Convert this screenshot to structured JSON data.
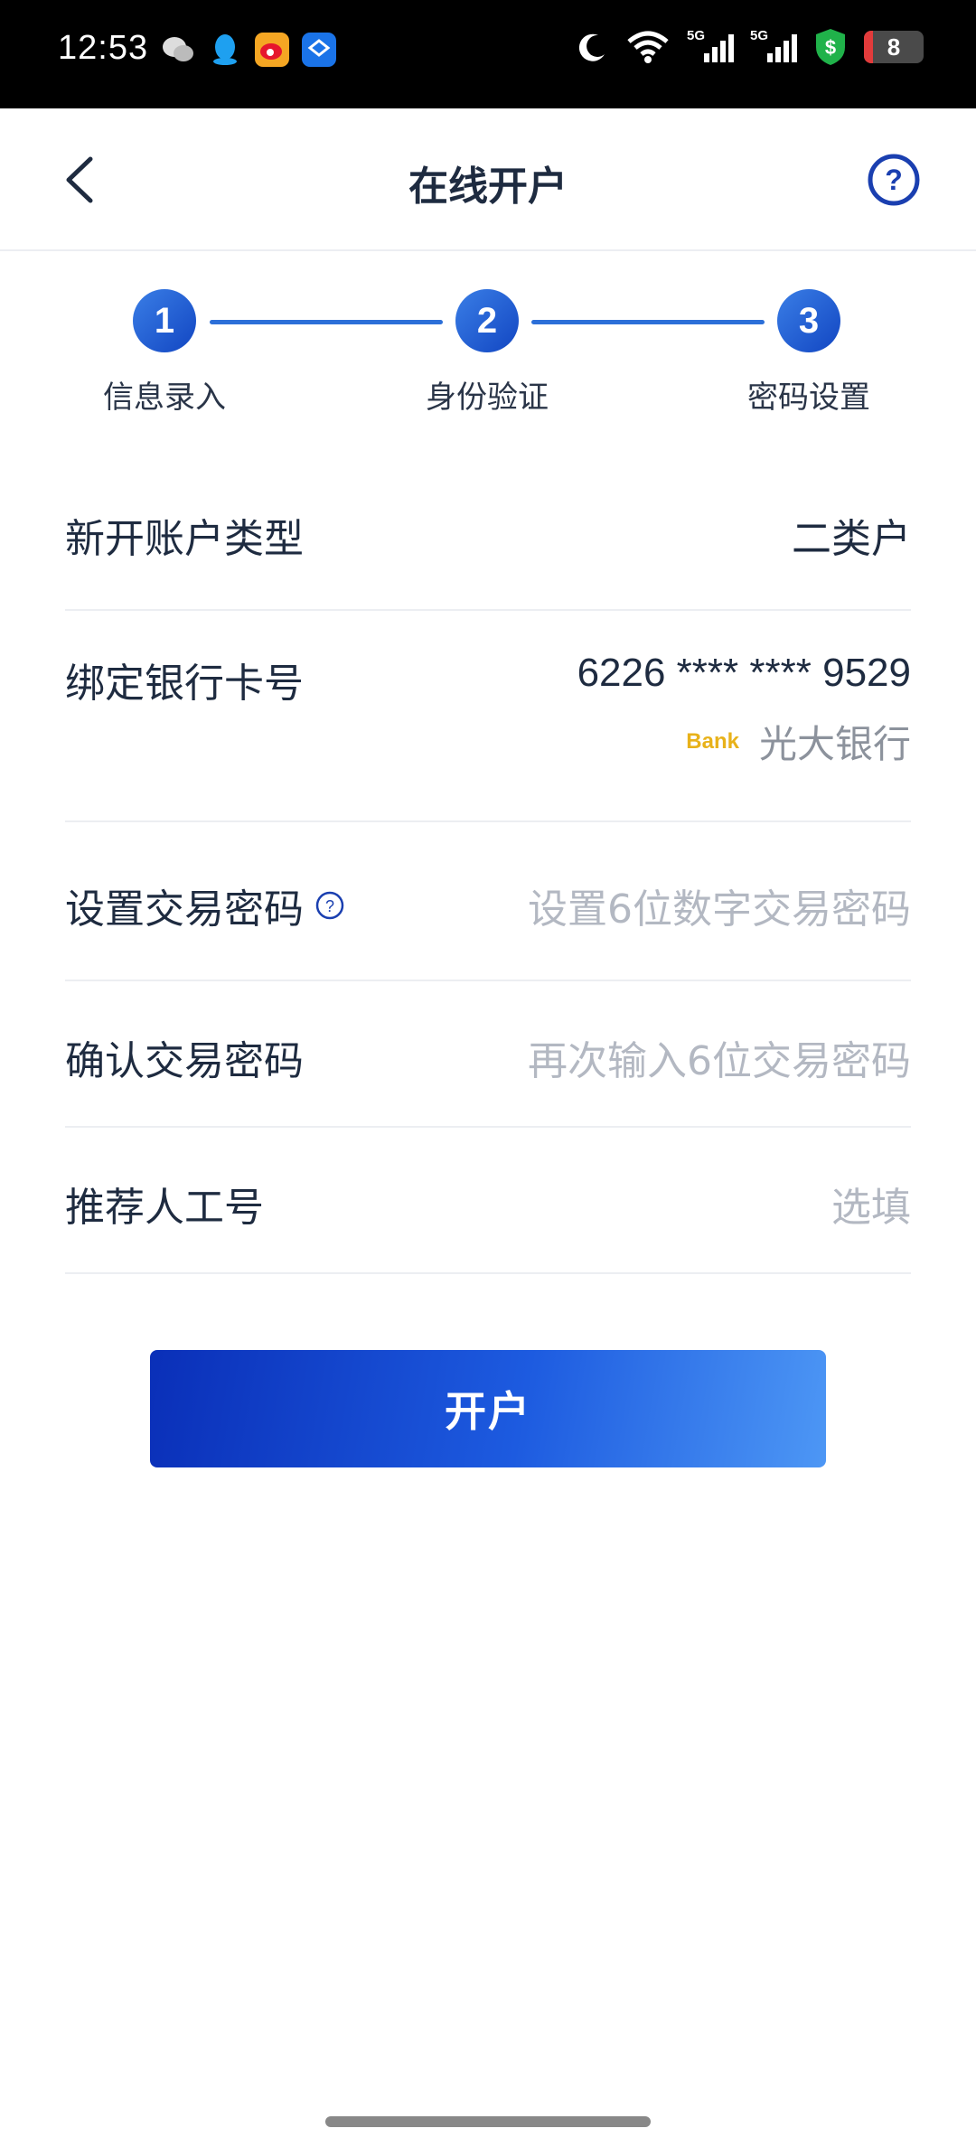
{
  "status": {
    "time": "12:53",
    "apps": [
      "wechat-icon",
      "qq-icon",
      "weibo-icon",
      "bank-app-icon"
    ],
    "signal_labels": [
      "5G",
      "5G"
    ],
    "battery_level": "8"
  },
  "nav": {
    "title": "在线开户"
  },
  "steps": [
    {
      "num": "1",
      "label": "信息录入"
    },
    {
      "num": "2",
      "label": "身份验证"
    },
    {
      "num": "3",
      "label": "密码设置"
    }
  ],
  "form": {
    "account_type": {
      "label": "新开账户类型",
      "value": "二类户"
    },
    "bank_card": {
      "label": "绑定银行卡号",
      "value": "6226 **** **** 9529",
      "bank_logo_text": "Bank",
      "bank_name": "光大银行"
    },
    "trade_password": {
      "label": "设置交易密码",
      "placeholder": "设置6位数字交易密码"
    },
    "confirm_password": {
      "label": "确认交易密码",
      "placeholder": "再次输入6位交易密码"
    },
    "referrer": {
      "label": "推荐人工号",
      "placeholder": "选填"
    }
  },
  "submit_label": "开户",
  "colors": {
    "primary": "#1d5be0",
    "placeholder": "#b3b8c2",
    "divider": "#eceef2"
  }
}
